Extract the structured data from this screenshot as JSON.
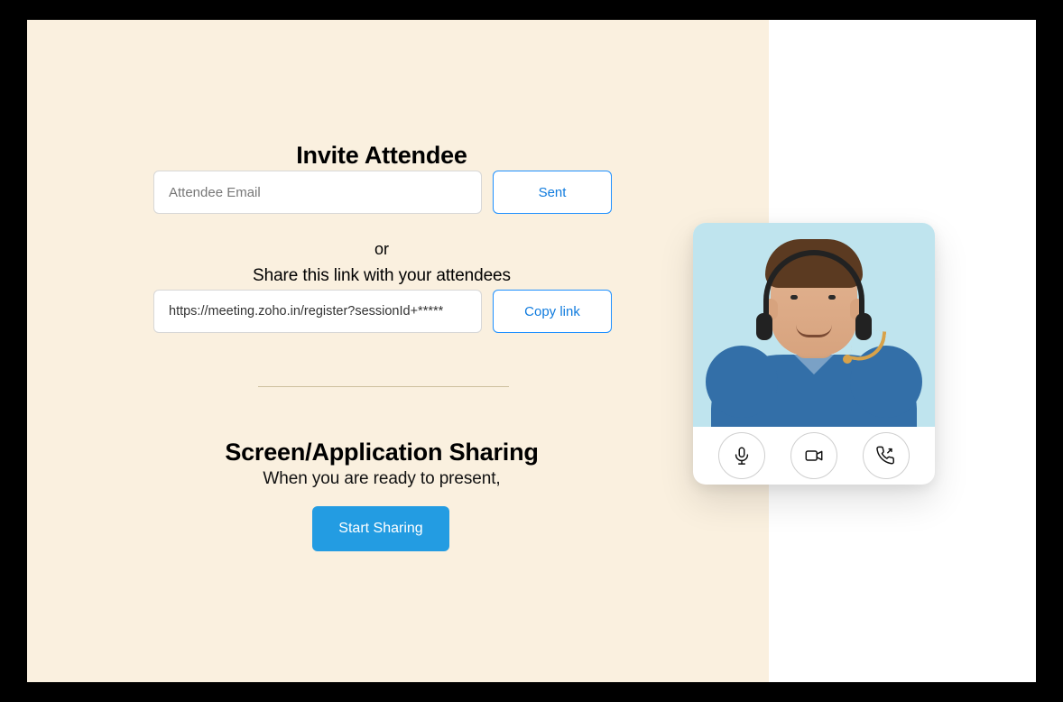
{
  "invite": {
    "title": "Invite Attendee",
    "email_placeholder": "Attendee Email",
    "sent_label": "Sent",
    "or_label": "or",
    "share_text": "Share this link with your attendees",
    "link_value": "https://meeting.zoho.in/register?sessionId+*****",
    "copy_label": "Copy link"
  },
  "sharing": {
    "title": "Screen/Application Sharing",
    "subtitle": "When you are ready to present,",
    "start_label": "Start Sharing"
  },
  "video": {
    "controls": {
      "mic": "microphone-icon",
      "camera": "video-icon",
      "phone": "phone-icon"
    }
  }
}
